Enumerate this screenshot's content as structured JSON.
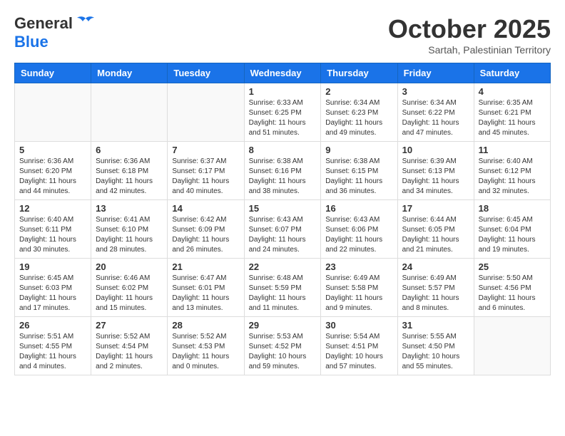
{
  "header": {
    "logo_general": "General",
    "logo_blue": "Blue",
    "month": "October 2025",
    "location": "Sartah, Palestinian Territory"
  },
  "days_of_week": [
    "Sunday",
    "Monday",
    "Tuesday",
    "Wednesday",
    "Thursday",
    "Friday",
    "Saturday"
  ],
  "weeks": [
    [
      {
        "day": "",
        "info": ""
      },
      {
        "day": "",
        "info": ""
      },
      {
        "day": "",
        "info": ""
      },
      {
        "day": "1",
        "info": "Sunrise: 6:33 AM\nSunset: 6:25 PM\nDaylight: 11 hours\nand 51 minutes."
      },
      {
        "day": "2",
        "info": "Sunrise: 6:34 AM\nSunset: 6:23 PM\nDaylight: 11 hours\nand 49 minutes."
      },
      {
        "day": "3",
        "info": "Sunrise: 6:34 AM\nSunset: 6:22 PM\nDaylight: 11 hours\nand 47 minutes."
      },
      {
        "day": "4",
        "info": "Sunrise: 6:35 AM\nSunset: 6:21 PM\nDaylight: 11 hours\nand 45 minutes."
      }
    ],
    [
      {
        "day": "5",
        "info": "Sunrise: 6:36 AM\nSunset: 6:20 PM\nDaylight: 11 hours\nand 44 minutes."
      },
      {
        "day": "6",
        "info": "Sunrise: 6:36 AM\nSunset: 6:18 PM\nDaylight: 11 hours\nand 42 minutes."
      },
      {
        "day": "7",
        "info": "Sunrise: 6:37 AM\nSunset: 6:17 PM\nDaylight: 11 hours\nand 40 minutes."
      },
      {
        "day": "8",
        "info": "Sunrise: 6:38 AM\nSunset: 6:16 PM\nDaylight: 11 hours\nand 38 minutes."
      },
      {
        "day": "9",
        "info": "Sunrise: 6:38 AM\nSunset: 6:15 PM\nDaylight: 11 hours\nand 36 minutes."
      },
      {
        "day": "10",
        "info": "Sunrise: 6:39 AM\nSunset: 6:13 PM\nDaylight: 11 hours\nand 34 minutes."
      },
      {
        "day": "11",
        "info": "Sunrise: 6:40 AM\nSunset: 6:12 PM\nDaylight: 11 hours\nand 32 minutes."
      }
    ],
    [
      {
        "day": "12",
        "info": "Sunrise: 6:40 AM\nSunset: 6:11 PM\nDaylight: 11 hours\nand 30 minutes."
      },
      {
        "day": "13",
        "info": "Sunrise: 6:41 AM\nSunset: 6:10 PM\nDaylight: 11 hours\nand 28 minutes."
      },
      {
        "day": "14",
        "info": "Sunrise: 6:42 AM\nSunset: 6:09 PM\nDaylight: 11 hours\nand 26 minutes."
      },
      {
        "day": "15",
        "info": "Sunrise: 6:43 AM\nSunset: 6:07 PM\nDaylight: 11 hours\nand 24 minutes."
      },
      {
        "day": "16",
        "info": "Sunrise: 6:43 AM\nSunset: 6:06 PM\nDaylight: 11 hours\nand 22 minutes."
      },
      {
        "day": "17",
        "info": "Sunrise: 6:44 AM\nSunset: 6:05 PM\nDaylight: 11 hours\nand 21 minutes."
      },
      {
        "day": "18",
        "info": "Sunrise: 6:45 AM\nSunset: 6:04 PM\nDaylight: 11 hours\nand 19 minutes."
      }
    ],
    [
      {
        "day": "19",
        "info": "Sunrise: 6:45 AM\nSunset: 6:03 PM\nDaylight: 11 hours\nand 17 minutes."
      },
      {
        "day": "20",
        "info": "Sunrise: 6:46 AM\nSunset: 6:02 PM\nDaylight: 11 hours\nand 15 minutes."
      },
      {
        "day": "21",
        "info": "Sunrise: 6:47 AM\nSunset: 6:01 PM\nDaylight: 11 hours\nand 13 minutes."
      },
      {
        "day": "22",
        "info": "Sunrise: 6:48 AM\nSunset: 5:59 PM\nDaylight: 11 hours\nand 11 minutes."
      },
      {
        "day": "23",
        "info": "Sunrise: 6:49 AM\nSunset: 5:58 PM\nDaylight: 11 hours\nand 9 minutes."
      },
      {
        "day": "24",
        "info": "Sunrise: 6:49 AM\nSunset: 5:57 PM\nDaylight: 11 hours\nand 8 minutes."
      },
      {
        "day": "25",
        "info": "Sunrise: 5:50 AM\nSunset: 4:56 PM\nDaylight: 11 hours\nand 6 minutes."
      }
    ],
    [
      {
        "day": "26",
        "info": "Sunrise: 5:51 AM\nSunset: 4:55 PM\nDaylight: 11 hours\nand 4 minutes."
      },
      {
        "day": "27",
        "info": "Sunrise: 5:52 AM\nSunset: 4:54 PM\nDaylight: 11 hours\nand 2 minutes."
      },
      {
        "day": "28",
        "info": "Sunrise: 5:52 AM\nSunset: 4:53 PM\nDaylight: 11 hours\nand 0 minutes."
      },
      {
        "day": "29",
        "info": "Sunrise: 5:53 AM\nSunset: 4:52 PM\nDaylight: 10 hours\nand 59 minutes."
      },
      {
        "day": "30",
        "info": "Sunrise: 5:54 AM\nSunset: 4:51 PM\nDaylight: 10 hours\nand 57 minutes."
      },
      {
        "day": "31",
        "info": "Sunrise: 5:55 AM\nSunset: 4:50 PM\nDaylight: 10 hours\nand 55 minutes."
      },
      {
        "day": "",
        "info": ""
      }
    ]
  ]
}
